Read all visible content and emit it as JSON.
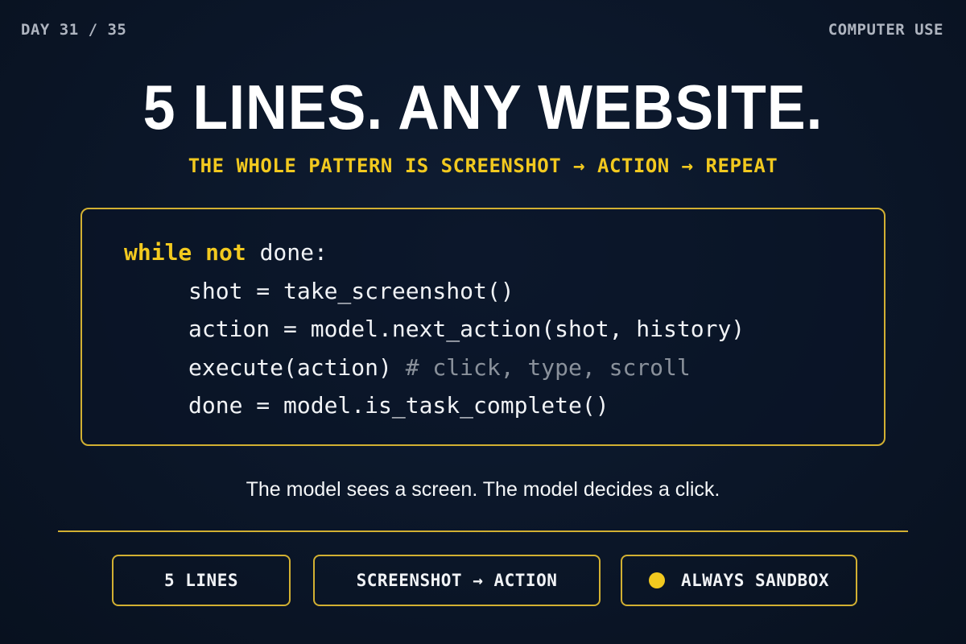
{
  "header": {
    "progress_label": "DAY 31 / 35",
    "topic_label": "COMPUTER USE"
  },
  "title": "5 LINES. ANY WEBSITE.",
  "subtitle": "THE WHOLE PATTERN IS SCREENSHOT → ACTION → REPEAT",
  "code": {
    "line1_kw": "while not",
    "line1_rest": " done:",
    "line2": "shot = take_screenshot()",
    "line3": "action = model.next_action(shot, history)",
    "line4_code": "execute(action) ",
    "line4_comment": "# click, type, scroll",
    "line5": "done = model.is_task_complete()"
  },
  "caption": "The model sees a screen. The model decides a click.",
  "pills": [
    {
      "label": "5 LINES"
    },
    {
      "label": "SCREENSHOT → ACTION"
    },
    {
      "label": "ALWAYS SANDBOX"
    }
  ],
  "colors": {
    "accent": "#f2c91f",
    "background": "#0b1628",
    "comment": "#8a919b"
  }
}
